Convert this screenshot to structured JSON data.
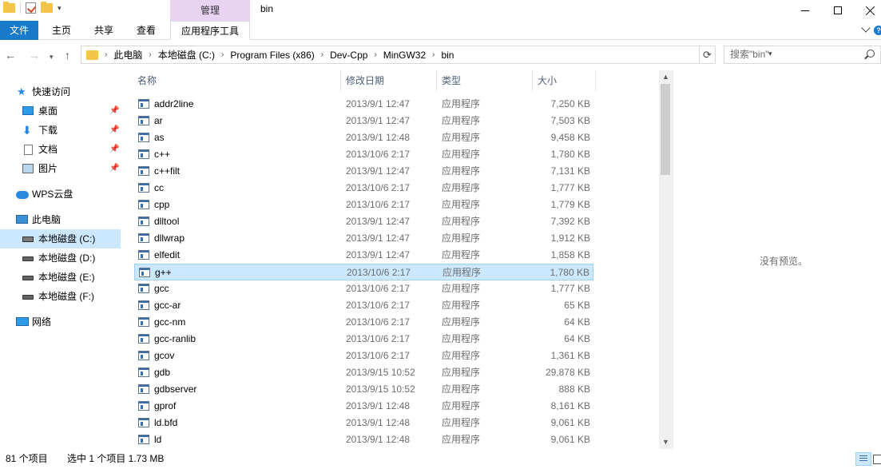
{
  "window": {
    "title": "bin",
    "context_group": "管理"
  },
  "ribbon": {
    "tabs": [
      "文件",
      "主页",
      "共享",
      "查看",
      "应用程序工具"
    ]
  },
  "address": {
    "crumbs": [
      "此电脑",
      "本地磁盘 (C:)",
      "Program Files (x86)",
      "Dev-Cpp",
      "MinGW32",
      "bin"
    ],
    "search_placeholder": "搜索\"bin\""
  },
  "sidebar": {
    "quick_access": "快速访问",
    "items": [
      {
        "label": "桌面"
      },
      {
        "label": "下载"
      },
      {
        "label": "文档"
      },
      {
        "label": "图片"
      }
    ],
    "wps": "WPS云盘",
    "this_pc": "此电脑",
    "drives": [
      {
        "label": "本地磁盘 (C:)"
      },
      {
        "label": "本地磁盘 (D:)"
      },
      {
        "label": "本地磁盘 (E:)"
      },
      {
        "label": "本地磁盘 (F:)"
      }
    ],
    "network": "网络"
  },
  "columns": {
    "name": "名称",
    "date": "修改日期",
    "type": "类型",
    "size": "大小"
  },
  "files": [
    {
      "name": "addr2line",
      "date": "2013/9/1 12:47",
      "type": "应用程序",
      "size": "7,250 KB"
    },
    {
      "name": "ar",
      "date": "2013/9/1 12:47",
      "type": "应用程序",
      "size": "7,503 KB"
    },
    {
      "name": "as",
      "date": "2013/9/1 12:48",
      "type": "应用程序",
      "size": "9,458 KB"
    },
    {
      "name": "c++",
      "date": "2013/10/6 2:17",
      "type": "应用程序",
      "size": "1,780 KB"
    },
    {
      "name": "c++filt",
      "date": "2013/9/1 12:47",
      "type": "应用程序",
      "size": "7,131 KB"
    },
    {
      "name": "cc",
      "date": "2013/10/6 2:17",
      "type": "应用程序",
      "size": "1,777 KB"
    },
    {
      "name": "cpp",
      "date": "2013/10/6 2:17",
      "type": "应用程序",
      "size": "1,779 KB"
    },
    {
      "name": "dlltool",
      "date": "2013/9/1 12:47",
      "type": "应用程序",
      "size": "7,392 KB"
    },
    {
      "name": "dllwrap",
      "date": "2013/9/1 12:47",
      "type": "应用程序",
      "size": "1,912 KB"
    },
    {
      "name": "elfedit",
      "date": "2013/9/1 12:47",
      "type": "应用程序",
      "size": "1,858 KB"
    },
    {
      "name": "g++",
      "date": "2013/10/6 2:17",
      "type": "应用程序",
      "size": "1,780 KB"
    },
    {
      "name": "gcc",
      "date": "2013/10/6 2:17",
      "type": "应用程序",
      "size": "1,777 KB"
    },
    {
      "name": "gcc-ar",
      "date": "2013/10/6 2:17",
      "type": "应用程序",
      "size": "65 KB"
    },
    {
      "name": "gcc-nm",
      "date": "2013/10/6 2:17",
      "type": "应用程序",
      "size": "64 KB"
    },
    {
      "name": "gcc-ranlib",
      "date": "2013/10/6 2:17",
      "type": "应用程序",
      "size": "64 KB"
    },
    {
      "name": "gcov",
      "date": "2013/10/6 2:17",
      "type": "应用程序",
      "size": "1,361 KB"
    },
    {
      "name": "gdb",
      "date": "2013/9/15 10:52",
      "type": "应用程序",
      "size": "29,878 KB"
    },
    {
      "name": "gdbserver",
      "date": "2013/9/15 10:52",
      "type": "应用程序",
      "size": "888 KB"
    },
    {
      "name": "gprof",
      "date": "2013/9/1 12:48",
      "type": "应用程序",
      "size": "8,161 KB"
    },
    {
      "name": "ld.bfd",
      "date": "2013/9/1 12:48",
      "type": "应用程序",
      "size": "9,061 KB"
    },
    {
      "name": "ld",
      "date": "2013/9/1 12:48",
      "type": "应用程序",
      "size": "9,061 KB"
    }
  ],
  "selected_file": "g++",
  "preview": {
    "text": "没有预览。"
  },
  "status": {
    "count": "81 个项目",
    "selection": "选中 1 个项目  1.73 MB"
  },
  "icons": {
    "folder": "folder-icon",
    "properties": "properties-icon",
    "app": "application-icon",
    "pin": "pin-icon",
    "search": "search-icon"
  },
  "colors": {
    "file_tab": "#1979ca",
    "context_group": "#e8d3f3",
    "selection": "#cce8ff",
    "header_text": "#4c607a"
  }
}
